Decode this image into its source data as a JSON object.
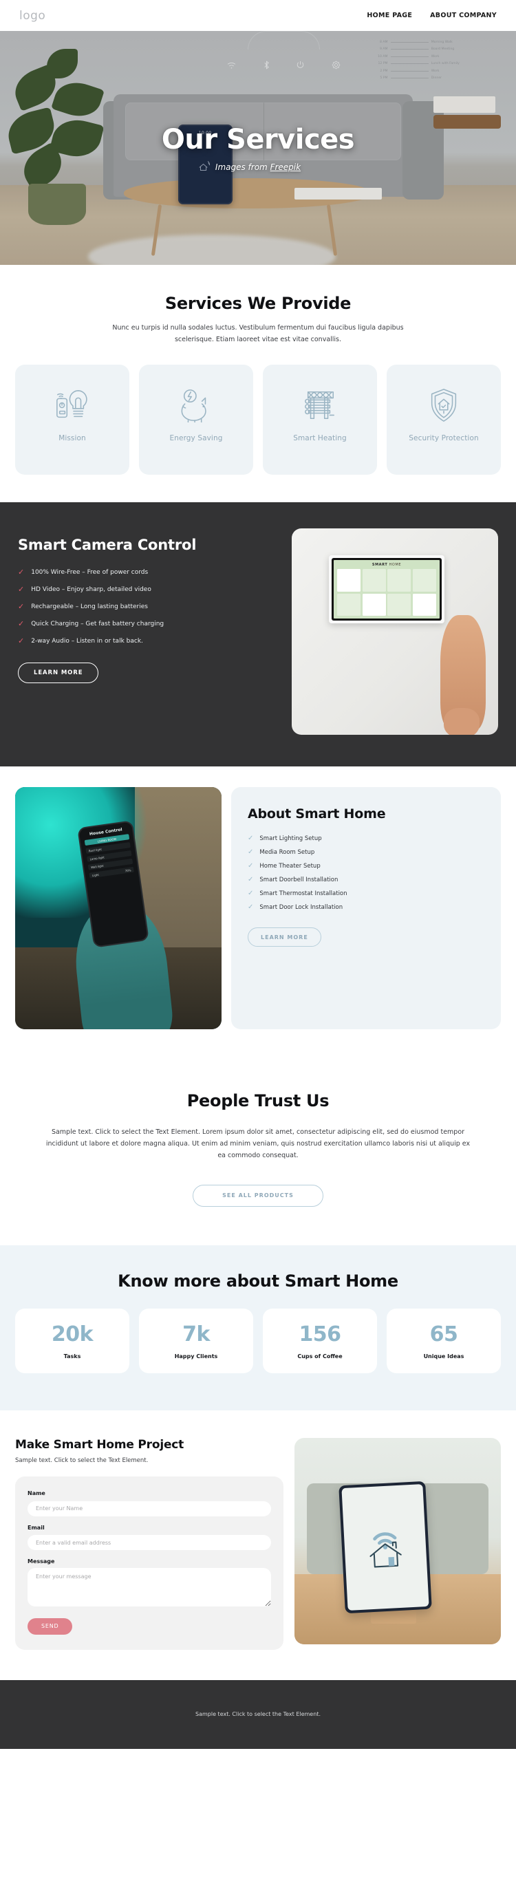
{
  "header": {
    "logo": "logo",
    "nav": [
      {
        "label": "HOME PAGE"
      },
      {
        "label": "ABOUT COMPANY"
      }
    ]
  },
  "hero": {
    "title": "Our Services",
    "credit_prefix": "Images from ",
    "credit_link": "Freepik",
    "phone_time": "10:00",
    "schedule": [
      {
        "time": "8 AM",
        "name": "Morning Walk"
      },
      {
        "time": "9 AM",
        "name": "Board Meeting"
      },
      {
        "time": "10 AM",
        "name": "Work"
      },
      {
        "time": "12 PM",
        "name": "Lunch with Family"
      },
      {
        "time": "2 PM",
        "name": "Work"
      },
      {
        "time": "5 PM",
        "name": "Dinner"
      }
    ]
  },
  "services": {
    "title": "Services We Provide",
    "text": "Nunc eu turpis id nulla sodales luctus. Vestibulum fermentum dui faucibus ligula dapibus scelerisque. Etiam laoreet vitae est vitae convallis.",
    "cards": [
      {
        "label": "Mission",
        "icon": "smart-bulb-remote-icon"
      },
      {
        "label": "Energy Saving",
        "icon": "piggy-bank-energy-icon"
      },
      {
        "label": "Smart Heating",
        "icon": "radiator-icon"
      },
      {
        "label": "Security\nProtection",
        "icon": "shield-house-icon"
      }
    ]
  },
  "camera": {
    "title": "Smart Camera Control",
    "features": [
      "100% Wire-Free – Free of power cords",
      "HD Video – Enjoy sharp, detailed video",
      "Rechargeable – Long lasting batteries",
      "Quick Charging – Get fast battery charging",
      "2-way Audio – Listen in or talk back."
    ],
    "button": "LEARN MORE",
    "panel_title_bold": "SMART",
    "panel_title_rest": " HOME"
  },
  "about": {
    "title": "About Smart Home",
    "items": [
      "Smart Lighting Setup",
      "Media Room Setup",
      "Home Theater Setup",
      "Smart Doorbell Installation",
      "Smart Thermostat Installation",
      "Smart Door Lock Installation"
    ],
    "button": "LEARN MORE",
    "phone_title": "House Control",
    "phone_rows": [
      "LIVING ROOM",
      "Roof light",
      "Lamp light",
      "Wall light",
      "Light"
    ],
    "phone_percent": "70%"
  },
  "trust": {
    "title": "People Trust Us",
    "text": "Sample text. Click to select the Text Element. Lorem ipsum dolor sit amet, consectetur adipiscing elit, sed do eiusmod tempor incididunt ut labore et dolore magna aliqua. Ut enim ad minim veniam, quis nostrud exercitation ullamco laboris nisi ut aliquip ex ea commodo consequat.",
    "button": "SEE ALL PRODUCTS"
  },
  "stats": {
    "title": "Know more about Smart Home",
    "items": [
      {
        "value": "20k",
        "label": "Tasks"
      },
      {
        "value": "7k",
        "label": "Happy Clients"
      },
      {
        "value": "156",
        "label": "Cups of Coffee"
      },
      {
        "value": "65",
        "label": "Unique Ideas"
      }
    ]
  },
  "contact": {
    "title": "Make Smart Home Project",
    "subtitle": "Sample text. Click to select the Text Element.",
    "fields": {
      "name_label": "Name",
      "name_placeholder": "Enter your Name",
      "email_label": "Email",
      "email_placeholder": "Enter a valid email address",
      "message_label": "Message",
      "message_placeholder": "Enter your message"
    },
    "send_button": "SEND"
  },
  "footer": {
    "text": "Sample text. Click to select the Text Element."
  },
  "colors": {
    "accent_blue": "#8fb6c9",
    "card_bg": "#eef3f6",
    "dark_bg": "#333334",
    "stats_bg": "#eef4f8",
    "tick_red": "#e25a6b",
    "send_pink": "#e0828c"
  },
  "chart_data": null
}
